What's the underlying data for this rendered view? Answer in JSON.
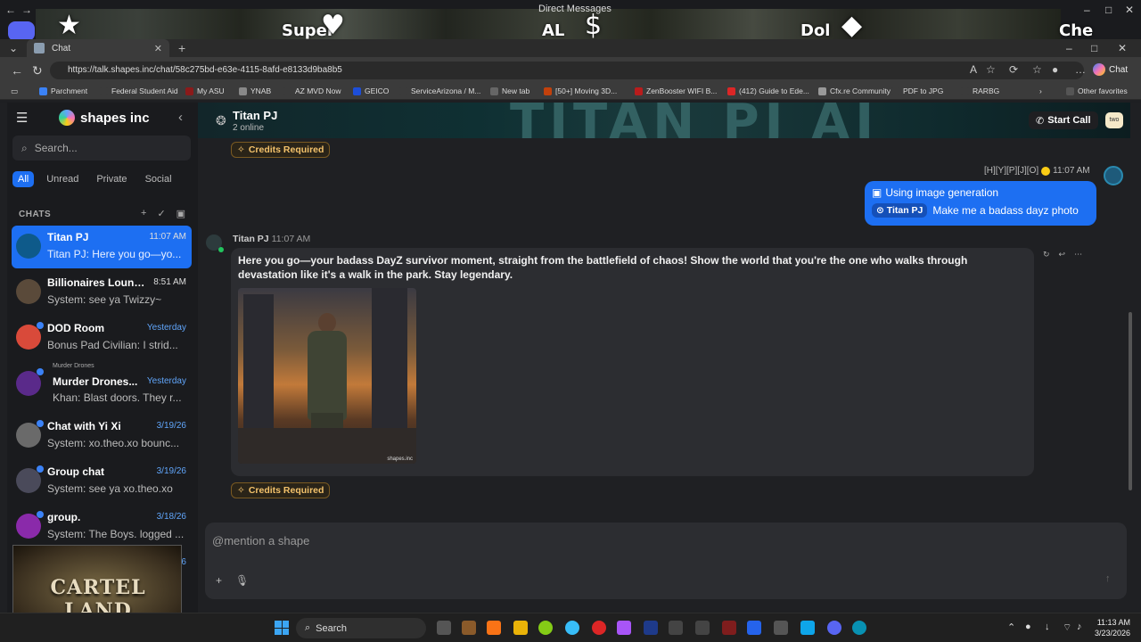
{
  "window": {
    "title": "Direct Messages",
    "strip_words": [
      "Super",
      "AL",
      "Dol",
      "Che"
    ],
    "strip_emojis": [
      "★",
      "♥",
      "$",
      "◆"
    ]
  },
  "browser": {
    "tab_title": "Chat",
    "url": "https://talk.shapes.inc/chat/58c275bd-e63e-4115-8afd-e8133d9ba8b5",
    "copilot_label": "Chat",
    "bookmarks": [
      "Parchment",
      "Federal Student Aid",
      "My ASU",
      "YNAB",
      "AZ MVD Now",
      "GEICO",
      "ServiceArizona / M...",
      "New tab",
      "[50+] Moving 3D...",
      "ZenBooster WIFI B...",
      "(412) Guide to Ede...",
      "Cfx.re Community",
      "PDF to JPG",
      "RARBG"
    ],
    "other_favorites": "Other favorites"
  },
  "sidebar": {
    "brand": "shapes inc",
    "search_placeholder": "Search...",
    "filters": [
      "All",
      "Unread",
      "Private",
      "Social"
    ],
    "chats_heading": "CHATS",
    "chats": [
      {
        "name": "Titan PJ",
        "time": "11:07 AM",
        "preview": "Titan PJ: Here you go—yo...",
        "color": "#0e5a8a"
      },
      {
        "name": "Billionaires Loung...",
        "time": "8:51 AM",
        "preview": "System: see ya Twizzy~",
        "color": "#5a4a3a"
      },
      {
        "name": "DOD Room",
        "time": "Yesterday",
        "preview": "Bonus Pad Civilian: I strid...",
        "color": "#d94a3a"
      },
      {
        "sup": "Murder Drones",
        "name": "Murder Drones...",
        "time": "Yesterday",
        "preview": "Khan: Blast doors. They r...",
        "color": "#5a2a8a"
      },
      {
        "name": "Chat with Yi Xi",
        "time": "3/19/26",
        "preview": "System: xo.theo.xo bounc...",
        "color": "#6a6a6a"
      },
      {
        "name": "Group chat",
        "time": "3/19/26",
        "preview": "System: see ya xo.theo.xo",
        "color": "#4a4a5a"
      },
      {
        "name": "group.",
        "time": "3/18/26",
        "preview": "System: The Boys. logged ...",
        "color": "#8a2aaa"
      },
      {
        "time": "26"
      }
    ],
    "webcam_text": "CARTEL LAND"
  },
  "room": {
    "name": "Titan PJ",
    "online": "2 online",
    "banner_text": "TITAN PJ AI",
    "start_call": "Start Call",
    "badge": "two"
  },
  "messages": {
    "credits_label": "Credits Required",
    "user_meta": "[H][Y][P][J][O]",
    "user_time": "11:07 AM",
    "user_tool": "Using image generation",
    "user_mention": "Titan PJ",
    "user_text": "Make me a badass dayz photo",
    "bot_name": "Titan PJ",
    "bot_time": "11:07 AM",
    "bot_text": "Here you go—your badass DayZ survivor moment, straight from the battlefield of chaos! Show the world that you're the one who walks through devastation like it's a walk in the park. Stay legendary.",
    "image_watermark": "shapes.inc"
  },
  "composer": {
    "placeholder": "@mention a shape"
  },
  "taskbar": {
    "search_label": "Search",
    "time": "11:13 AM",
    "date": "3/23/2026"
  }
}
